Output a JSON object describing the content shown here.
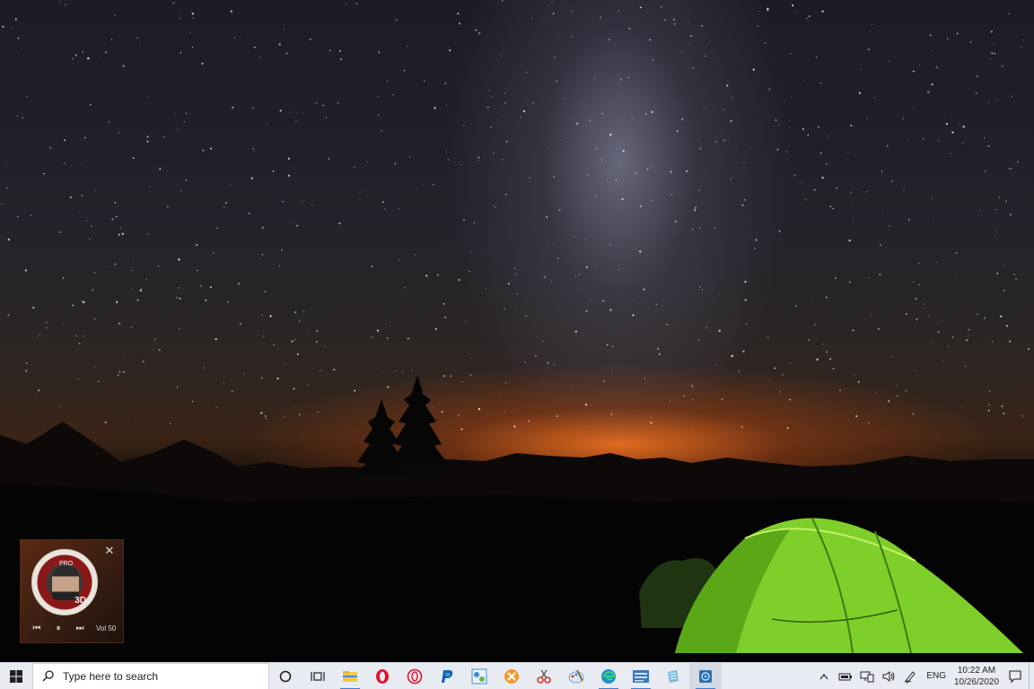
{
  "media_widget": {
    "close_glyph": "✕",
    "album_text": "3D",
    "album_label": "PRO",
    "prev_glyph": "⏮",
    "pause_glyph": "⏸",
    "next_glyph": "⏭",
    "volume_label": "Vol 50"
  },
  "taskbar": {
    "search_placeholder": "Type here to search",
    "pinned": [
      {
        "name": "cortana-icon"
      },
      {
        "name": "task-view-icon"
      },
      {
        "name": "file-explorer-icon",
        "color": "#f2c94c"
      },
      {
        "name": "opera-icon",
        "color": "#e0132c"
      },
      {
        "name": "opera-gx-icon",
        "color": "#e0132c"
      },
      {
        "name": "paypal-icon",
        "color": "#1b5fb5"
      },
      {
        "name": "control-panel-icon",
        "color": "#3d8fd6"
      },
      {
        "name": "xampp-icon",
        "color": "#f59a28"
      },
      {
        "name": "snipping-tool-icon",
        "color": "#d3392b"
      },
      {
        "name": "paint-icon",
        "color": "#6fa3d6"
      },
      {
        "name": "edge-icon",
        "color": "#1a8fd0"
      },
      {
        "name": "media-app-icon",
        "color": "#3a77b8"
      },
      {
        "name": "notes-icon",
        "color": "#7ab8e0"
      },
      {
        "name": "music-player-icon",
        "color": "#2c6fb0"
      }
    ],
    "tray": {
      "language": "ENG",
      "time": "10:22 AM",
      "date": "10/26/2020"
    }
  }
}
